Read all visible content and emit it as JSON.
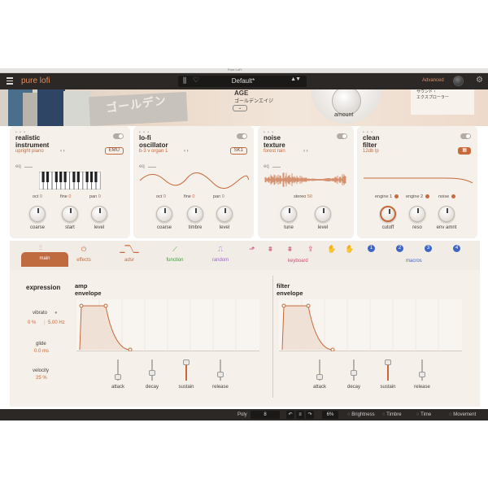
{
  "window": {
    "title": "Pure LoFi"
  },
  "header": {
    "app_title": "pure lofi",
    "preset_name": "Default*",
    "advanced_label": "Advanced",
    "nav_arrows": "▲▼"
  },
  "artwork": {
    "japanese_text": "ゴールデン",
    "age_label": "AGE",
    "age_japanese": "ゴールデンエイジ",
    "age_button": "⌄",
    "amount_label": "amount",
    "explorer_text_line1": "サウンド・",
    "explorer_text_line2": "エクスプローラー"
  },
  "panels": [
    {
      "title_line1": "realistic",
      "title_line2": "instrument",
      "subtitle": "upright piano",
      "chip": "EMU",
      "eq": "eq",
      "params": [
        {
          "label": "oct",
          "value": "0"
        },
        {
          "label": "fine",
          "value": "0"
        },
        {
          "label": "pan",
          "value": "0"
        }
      ],
      "knobs": [
        "coarse",
        "start",
        "level"
      ]
    },
    {
      "title_line1": "lo-fi",
      "title_line2": "oscillator",
      "subtitle": "b-3 v organ 1",
      "chip": "SK1",
      "eq": "eq",
      "params": [
        {
          "label": "oct",
          "value": "0"
        },
        {
          "label": "fine",
          "value": "0"
        },
        {
          "label": "pan",
          "value": "0"
        }
      ],
      "knobs": [
        "coarse",
        "timbre",
        "level"
      ]
    },
    {
      "title_line1": "noise",
      "title_line2": "texture",
      "subtitle": "forest rain",
      "eq": "eq",
      "params": [
        {
          "label": "stereo",
          "value": "50"
        }
      ],
      "knobs": [
        "tune",
        "level"
      ]
    },
    {
      "title_line1": "clean",
      "title_line2": "filter",
      "subtitle": "12db lp",
      "params": [
        {
          "label": "engine 1"
        },
        {
          "label": "engine 2"
        },
        {
          "label": "noise"
        }
      ],
      "knobs": [
        "cutoff",
        "reso",
        "env amnt"
      ]
    }
  ],
  "tabs": [
    {
      "label": "main",
      "color": "#ffffff"
    },
    {
      "label": "effects",
      "color": "#c66a3b"
    },
    {
      "label": "adsr",
      "color": "#c66a3b"
    },
    {
      "label": "function",
      "color": "#3c9a3c"
    },
    {
      "label": "random",
      "color": "#9a66c9"
    },
    {
      "label": "keyboard",
      "color": "#d24b6e"
    },
    {
      "label": "macros",
      "color": "#3f66c7"
    }
  ],
  "macro_numbers": [
    "1",
    "2",
    "3",
    "4"
  ],
  "expression": {
    "title": "expression",
    "vibrato_label": "vibrato",
    "vibrato_amount": "0 %",
    "vibrato_rate": "5.00 Hz",
    "glide_label": "glide",
    "glide_value": "0.0 ms",
    "velocity_label": "velocity",
    "velocity_value": "25 %"
  },
  "amp_envelope": {
    "title_line1": "amp",
    "title_line2": "envelope",
    "sliders": [
      {
        "label": "attack",
        "level": 0.05
      },
      {
        "label": "decay",
        "level": 0.3
      },
      {
        "label": "sustain",
        "level": 1.0
      },
      {
        "label": "release",
        "level": 0.2
      }
    ]
  },
  "filter_envelope": {
    "title_line1": "filter",
    "title_line2": "envelope",
    "sliders": [
      {
        "label": "attack",
        "level": 0.05
      },
      {
        "label": "decay",
        "level": 0.3
      },
      {
        "label": "sustain",
        "level": 1.0
      },
      {
        "label": "release",
        "level": 0.2
      }
    ]
  },
  "bottom_bar": {
    "poly_label": "Poly",
    "poly_value": "8",
    "percent_value": "6%",
    "brightness": "Brightness",
    "timbre": "Timbre",
    "time": "Time",
    "movement": "Movement"
  },
  "colors": {
    "accent": "#c66a3b",
    "header_bg": "#2b2826",
    "panel_bg": "#f5f0ea"
  }
}
